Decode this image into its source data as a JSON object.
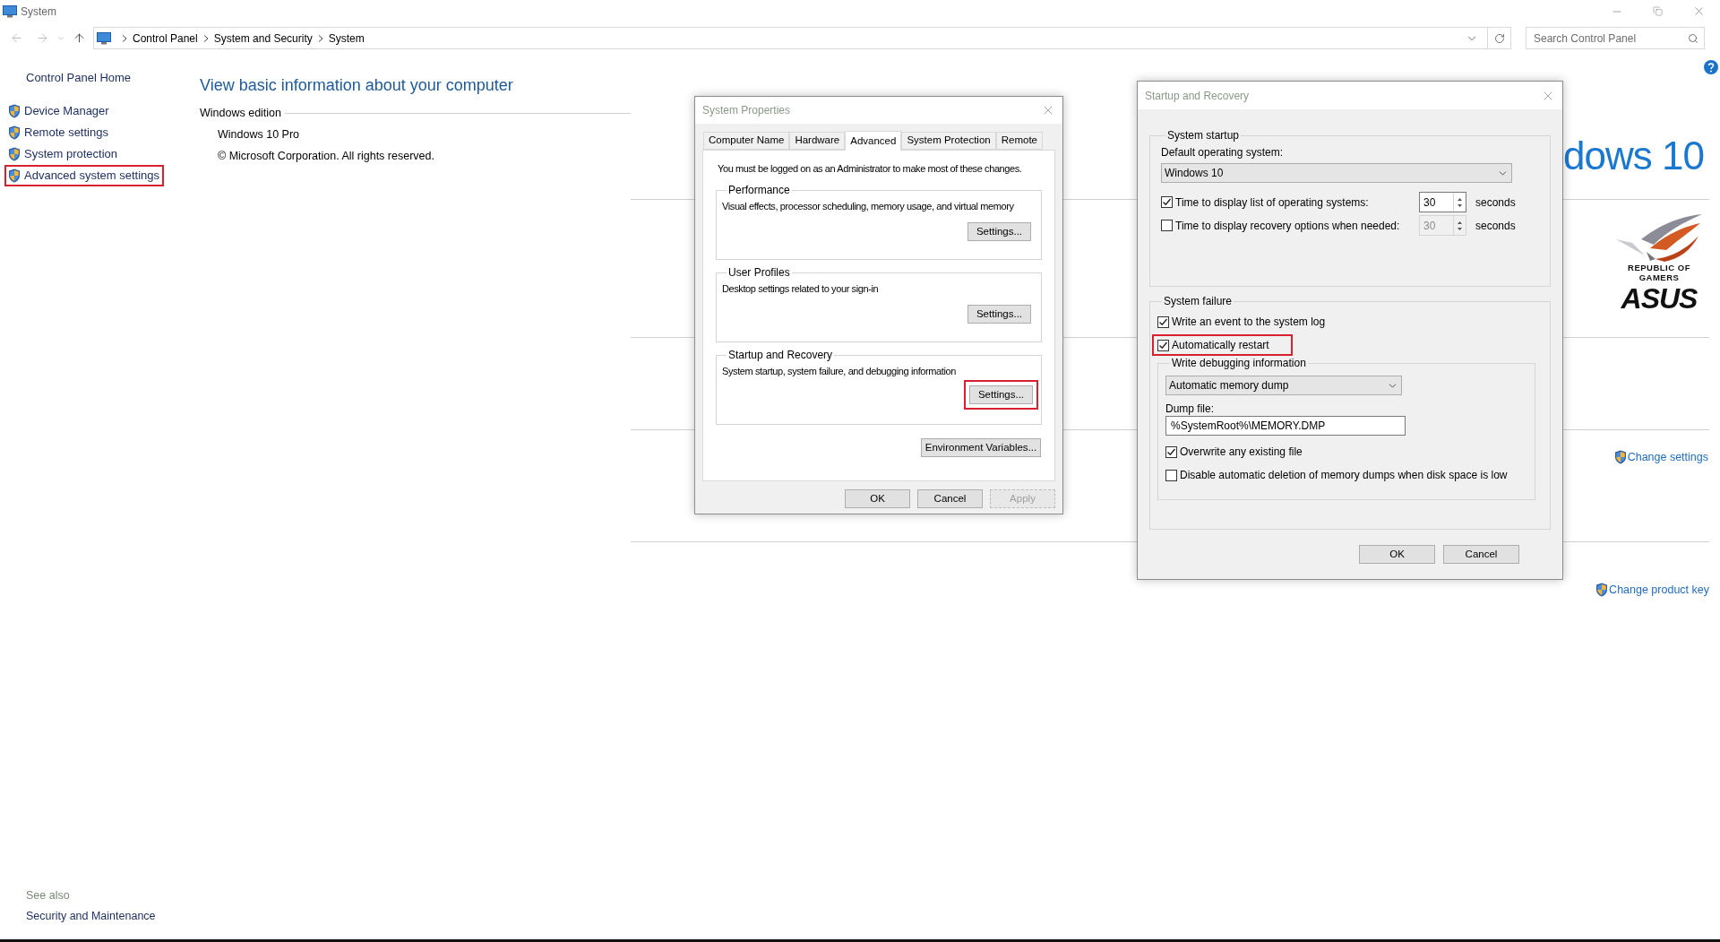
{
  "window": {
    "title": "System"
  },
  "address_bar": {
    "breadcrumbs": [
      "Control Panel",
      "System and Security",
      "System"
    ],
    "search": {
      "placeholder": "Search Control Panel"
    }
  },
  "sidebar": {
    "home": "Control Panel Home",
    "items": [
      {
        "label": "Device Manager",
        "annotated": false
      },
      {
        "label": "Remote settings",
        "annotated": false
      },
      {
        "label": "System protection",
        "annotated": false
      },
      {
        "label": "Advanced system settings",
        "annotated": true
      }
    ],
    "see_also": {
      "title": "See also",
      "links": [
        "Security and Maintenance"
      ]
    }
  },
  "main": {
    "heading": "View basic information about your computer",
    "edition": {
      "title": "Windows edition",
      "lines": [
        "Windows 10 Pro",
        "© Microsoft Corporation. All rights reserved."
      ],
      "logo_text": "dows 10"
    },
    "oem_logo": {
      "tagline": [
        "REPUBLIC OF",
        "GAMERS"
      ],
      "brand": "ASUS"
    },
    "links": [
      "Change settings",
      "Change product key"
    ]
  },
  "system_properties": {
    "title": "System Properties",
    "tabs": [
      {
        "label": "Computer Name",
        "selected": false
      },
      {
        "label": "Hardware",
        "selected": false
      },
      {
        "label": "Advanced",
        "selected": true
      },
      {
        "label": "System Protection",
        "selected": false
      },
      {
        "label": "Remote",
        "selected": false
      }
    ],
    "notice": "You must be logged on as an Administrator to make most of these changes.",
    "groups": [
      {
        "title": "Performance",
        "description": "Visual effects, processor scheduling, memory usage, and virtual memory",
        "button": "Settings...",
        "annotated": false
      },
      {
        "title": "User Profiles",
        "description": "Desktop settings related to your sign-in",
        "button": "Settings...",
        "annotated": false
      },
      {
        "title": "Startup and Recovery",
        "description": "System startup, system failure, and debugging information",
        "button": "Settings...",
        "annotated": true
      }
    ],
    "env_button": "Environment Variables...",
    "buttons": [
      {
        "label": "OK",
        "disabled": false
      },
      {
        "label": "Cancel",
        "disabled": false
      },
      {
        "label": "Apply",
        "disabled": true
      }
    ]
  },
  "startup_recovery": {
    "title": "Startup and Recovery",
    "startup": {
      "title": "System startup",
      "default_os_label": "Default operating system:",
      "default_os_value": "Windows 10",
      "rows": [
        {
          "label": "Time to display list of operating systems:",
          "checked": true,
          "value": "30",
          "disabled": false,
          "unit": "seconds"
        },
        {
          "label": "Time to display recovery options when needed:",
          "checked": false,
          "value": "30",
          "disabled": true,
          "unit": "seconds"
        }
      ]
    },
    "failure": {
      "title": "System failure",
      "options": [
        {
          "label": "Write an event to the system log",
          "checked": true,
          "annotated": false
        },
        {
          "label": "Automatically restart",
          "checked": true,
          "annotated": true
        }
      ],
      "debug": {
        "title": "Write debugging information",
        "type_value": "Automatic memory dump",
        "dump_label": "Dump file:",
        "dump_value": "%SystemRoot%\\MEMORY.DMP",
        "options": [
          {
            "label": "Overwrite any existing file",
            "checked": true
          },
          {
            "label": "Disable automatic deletion of memory dumps when disk space is low",
            "checked": false
          }
        ]
      }
    },
    "buttons": [
      {
        "label": "OK",
        "disabled": false
      },
      {
        "label": "Cancel",
        "disabled": false
      }
    ]
  }
}
